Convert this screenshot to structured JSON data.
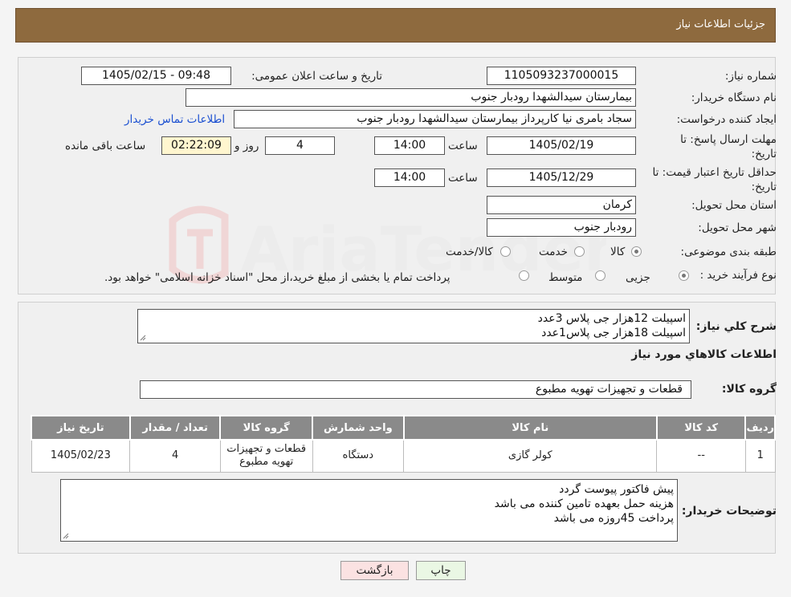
{
  "header": {
    "title": "جزئیات اطلاعات نیاز"
  },
  "form": {
    "need_number_label": "شماره نیاز:",
    "need_number": "1105093237000015",
    "announce_label": "تاریخ و ساعت اعلان عمومی:",
    "announce_value": "1405/02/15 - 09:48",
    "buyer_org_label": "نام دستگاه خریدار:",
    "buyer_org": "بیمارستان سیدالشهدا رودبار جنوب",
    "requester_label": "ایجاد کننده درخواست:",
    "requester": "سجاد بامری نیا کارپرداز بیمارستان سیدالشهدا رودبار جنوب",
    "contact_link": "اطلاعات تماس خریدار",
    "reply_deadline_label_1": "مهلت ارسال پاسخ: تا",
    "reply_deadline_label_2": "تاریخ:",
    "reply_date": "1405/02/19",
    "time_label": "ساعت",
    "reply_time": "14:00",
    "days_value": "4",
    "days_label": "روز و",
    "remaining_time": "02:22:09",
    "remaining_label": "ساعت باقی مانده",
    "price_validity_label_1": "حداقل تاریخ اعتبار قیمت: تا",
    "price_validity_label_2": "تاریخ:",
    "price_date": "1405/12/29",
    "price_time": "14:00",
    "province_label": "استان محل تحویل:",
    "province": "کرمان",
    "city_label": "شهر محل تحویل:",
    "city": "رودبار جنوب",
    "category_label": "طبقه بندی موضوعی:",
    "category_options": [
      "کالا",
      "خدمت",
      "کالا/خدمت"
    ],
    "process_label": "نوع فرآیند خرید :",
    "process_options": [
      "جزیی",
      "متوسط"
    ],
    "process_note": "پرداخت تمام یا بخشی از مبلغ خرید،از محل \"اسناد خزانه اسلامی\" خواهد بود."
  },
  "summary": {
    "label": "شرح کلي نياز:",
    "lines": [
      "اسپیلت 12هزار جی پلاس 3عدد",
      "اسپیلت 18هزار جی پلاس1عدد"
    ]
  },
  "goods": {
    "section_title": "اطلاعات کالاهاي مورد نياز",
    "group_label": "گروه کالا:",
    "group_value": "قطعات و تجهیزات تهویه مطبوع",
    "columns": [
      "رديف",
      "کد کالا",
      "نام کالا",
      "واحد شمارش",
      "گروه کالا",
      "تعداد / مقدار",
      "تاريخ نياز"
    ],
    "rows": [
      {
        "row": "1",
        "code": "--",
        "name": "کولر گازی",
        "unit": "دستگاه",
        "group_line1": "قطعات و تجهیزات",
        "group_line2": "تهویه مطبوع",
        "qty": "4",
        "date": "1405/02/23"
      }
    ]
  },
  "buyer_notes": {
    "label": "توضیحات خریدار:",
    "lines": [
      "پیش فاکتور پیوست گردد",
      "هزینه حمل بعهده تامین کننده می باشد",
      "پرداخت 45روزه می باشد"
    ]
  },
  "buttons": {
    "print": "چاپ",
    "back": "بازگشت"
  },
  "colors": {
    "header_bg": "#8e6a3e",
    "table_header_bg": "#8a8a8a",
    "print_btn_bg": "#eaf7e4",
    "back_btn_bg": "#fbe2e2",
    "remaining_bg": "#fff6cf",
    "link": "#1a4fd1"
  }
}
